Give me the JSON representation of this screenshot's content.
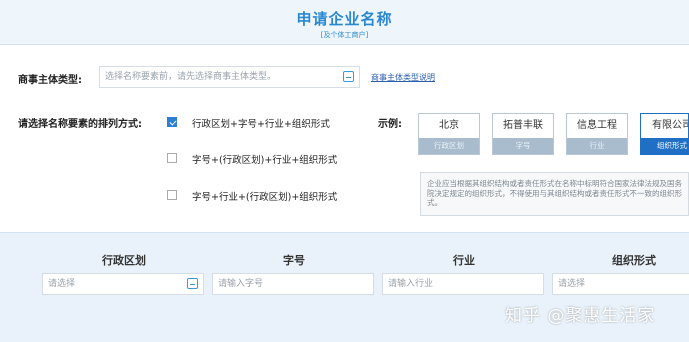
{
  "header": {
    "title": "申请企业名称",
    "subtitle": "[及个体工商户]"
  },
  "entity_type": {
    "label": "商事主体类型:",
    "placeholder": "选择名称要素前，请先选择商事主体类型。",
    "help_link": "商事主体类型说明"
  },
  "order": {
    "label": "请选择名称要素的排列方式:",
    "options": [
      {
        "label": "行政区划+字号+行业+组织形式",
        "checked": true
      },
      {
        "label": "字号+(行政区划)+行业+组织形式",
        "checked": false
      },
      {
        "label": "字号+行业+(行政区划)+组织形式",
        "checked": false
      }
    ]
  },
  "example": {
    "label": "示例:",
    "cards": [
      {
        "word": "北京",
        "part": "行政区划",
        "selected": false
      },
      {
        "word": "拓普丰联",
        "part": "字号",
        "selected": false
      },
      {
        "word": "信息工程",
        "part": "行业",
        "selected": false
      },
      {
        "word": "有限公司",
        "part": "组织形式",
        "selected": true
      }
    ],
    "hint": "企业应当根据其组织结构或者责任形式在名称中标明符合国家法律法规及国务院决定规定的组织形式，不得使用与其组织结构或者责任形式不一致的组织形式。"
  },
  "fields": [
    {
      "header": "行政区划",
      "placeholder": "请选择",
      "picker": true
    },
    {
      "header": "字号",
      "placeholder": "请输入字号",
      "picker": false
    },
    {
      "header": "行业",
      "placeholder": "请输入行业",
      "picker": false
    },
    {
      "header": "组织形式",
      "placeholder": "请选择",
      "picker": false
    }
  ],
  "watermark": "知乎 @聚惠生活家",
  "colors": {
    "accent": "#2a88d2",
    "selected": "#1f6fc5",
    "panel": "#e9f2fa"
  }
}
